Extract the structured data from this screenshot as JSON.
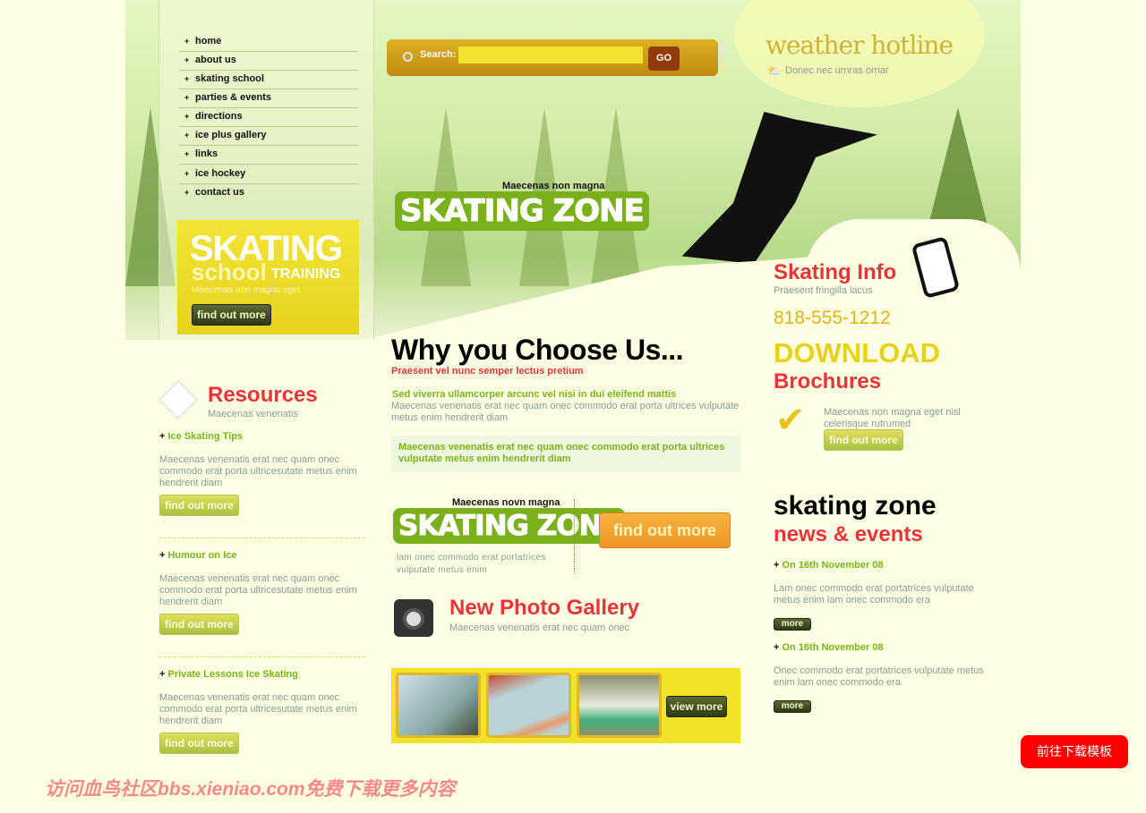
{
  "nav": {
    "items": [
      "home",
      "about us",
      "skating school",
      "parties & events",
      "directions",
      "ice plus gallery",
      "links",
      "ice hockey",
      "contact us"
    ]
  },
  "promo": {
    "title": "SKATING",
    "sub1": "school",
    "sub2": "TRAINING",
    "text": "Maecenas non magna eget",
    "button": "find out more"
  },
  "search": {
    "label": "Search:",
    "value": "",
    "button": "GO"
  },
  "hero": {
    "tagline": "Maecenas non magna",
    "logo": "SKATING ZONE"
  },
  "weather": {
    "title": "weather hotline",
    "text": "Donec nec urnras ornar"
  },
  "info": {
    "title": "Skating Info",
    "sub": "Praesent fringilla lacus",
    "phone": "818-555-1212",
    "download": "DOWNLOAD",
    "brochures": "Brochures",
    "text": "Maecenas non magna eget nisl celerisque rutrumed",
    "button": "find out more"
  },
  "why": {
    "title": "Why you Choose Us...",
    "sub": "Praesent vel nunc semper lectus pretium",
    "lead": "Sed viverra ullamcorper arcunc vel nisi in dui eleifend mattis",
    "text": "Maecenas venenatis erat nec quam onec commodo erat porta ultrices vulputate metus enim hendrerit diam",
    "box": "Maecenas venenatis erat nec quam onec commodo erat porta ultrices vulputate metus enim hendrerit diam"
  },
  "zone2": {
    "tagline": "Maecenas novn magna",
    "logo": "SKATING ZONE",
    "text": "lam onec commodo erat portatrices vulputate metus enim",
    "button": "find out more"
  },
  "gallery": {
    "title": "New Photo Gallery",
    "sub": "Maecenas venenatis erat nec quam onec",
    "button": "view more"
  },
  "resources": {
    "title": "Resources",
    "sub": "Maecenas venenatis",
    "items": [
      {
        "title": "Ice Skating Tips",
        "text": "Maecenas venenatis erat nec quam onec commodo erat porta ultricesutate metus enim hendrerit diam",
        "button": "find out more"
      },
      {
        "title": "Humour on Ice",
        "text": "Maecenas venenatis erat nec quam onec commodo erat porta ultricesutate metus enim hendrerit diam",
        "button": "find out more"
      },
      {
        "title": "Private Lessons Ice Skating",
        "text": "Maecenas venenatis erat nec quam onec commodo erat porta ultricesutate metus enim hendrerit diam",
        "button": "find out more"
      }
    ]
  },
  "news": {
    "title": "skating zone",
    "sub": "news & events",
    "items": [
      {
        "date": "On 16th November 08",
        "text": "Lam onec commodo erat portatrices vulputate metus enim lam onec commodo era",
        "button": "more"
      },
      {
        "date": "On 16th November 08",
        "text": "Onec commodo erat portatrices vulputate metus enim lam onec commodo era",
        "button": "more"
      }
    ]
  },
  "download_button": "前往下载模板",
  "watermark": "访问血鸟社区bbs.xieniao.com免费下载更多内容",
  "colors": {
    "background": "#fcffe2",
    "red": "#e8343a",
    "green": "#78b41a",
    "yellow": "#e6d21e",
    "orange": "#f39c2e"
  }
}
